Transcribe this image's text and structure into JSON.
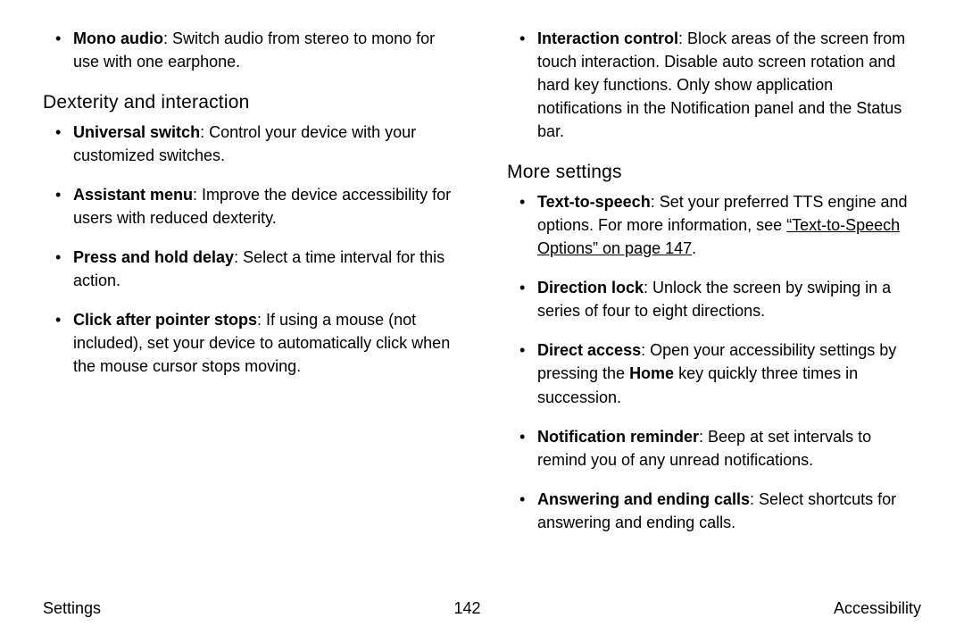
{
  "left": {
    "mono_audio": {
      "bold": "Mono audio",
      "rest": ": Switch audio from stereo to mono for use with one earphone."
    },
    "heading": "Dexterity and interaction",
    "items": [
      {
        "bold": "Universal switch",
        "rest": ": Control your device with your customized switches."
      },
      {
        "bold": "Assistant menu",
        "rest": ": Improve the device accessibility for users with reduced dexterity."
      },
      {
        "bold": "Press and hold delay",
        "rest": ": Select a time interval for this action."
      },
      {
        "bold": "Click after pointer stops",
        "rest": ": If using a mouse (not included), set your device to automatically click when the mouse cursor stops moving."
      }
    ]
  },
  "right": {
    "interaction_control": {
      "bold": "Interaction control",
      "rest": ": Block areas of the screen from touch interaction. Disable auto screen rotation and hard key functions. Only show application notifications in the Notification panel and the Status bar."
    },
    "heading": "More settings",
    "tts": {
      "bold": "Text-to-speech",
      "mid": ": Set your preferred TTS engine and options. For more information, see ",
      "link": "“Text-to-Speech Options” on page 147",
      "after": "."
    },
    "direction_lock": {
      "bold": "Direction lock",
      "rest": ": Unlock the screen by swiping in a series of four to eight directions."
    },
    "direct_access": {
      "bold": "Direct access",
      "pre": ": Open your accessibility settings by pressing the ",
      "home": "Home",
      "post": " key quickly three times in succession."
    },
    "notification_reminder": {
      "bold": "Notification reminder",
      "rest": ": Beep at set intervals to remind you of any unread notifications."
    },
    "answering": {
      "bold": "Answering and ending calls",
      "rest": ": Select shortcuts for answering and ending calls."
    }
  },
  "footer": {
    "left": "Settings",
    "center": "142",
    "right": "Accessibility"
  }
}
